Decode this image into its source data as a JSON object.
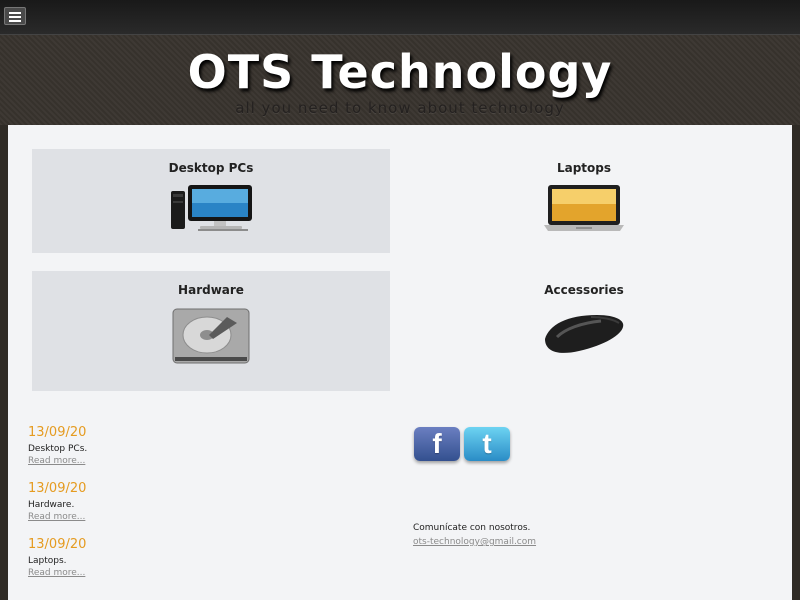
{
  "header": {
    "title": "OTS Technology",
    "subtitle": "all you need to know about technology"
  },
  "topbar": {
    "menu_icon": "menu-icon"
  },
  "categories": [
    {
      "label": "Desktop PCs",
      "icon": "desktop-pc-icon"
    },
    {
      "label": "Laptops",
      "icon": "laptop-icon"
    },
    {
      "label": "Hardware",
      "icon": "hard-drive-icon"
    },
    {
      "label": "Accessories",
      "icon": "mouse-icon"
    }
  ],
  "news": [
    {
      "date": "13/09/20",
      "text": "Desktop PCs.",
      "link": "Read more..."
    },
    {
      "date": "13/09/20",
      "text": "Hardware.",
      "link": "Read more..."
    },
    {
      "date": "13/09/20",
      "text": "Laptops.",
      "link": "Read more..."
    }
  ],
  "social": {
    "facebook_icon": "facebook-icon",
    "twitter_icon": "twitter-icon",
    "facebook_glyph": "f",
    "twitter_glyph": "t"
  },
  "contact": {
    "text": "Comunícate con nosotros.",
    "email": "ots-technology@gmail.com"
  },
  "colors": {
    "accent_date": "#e59b20",
    "shaded_card": "#dfe1e5",
    "link_gray": "#8b8b8b"
  }
}
